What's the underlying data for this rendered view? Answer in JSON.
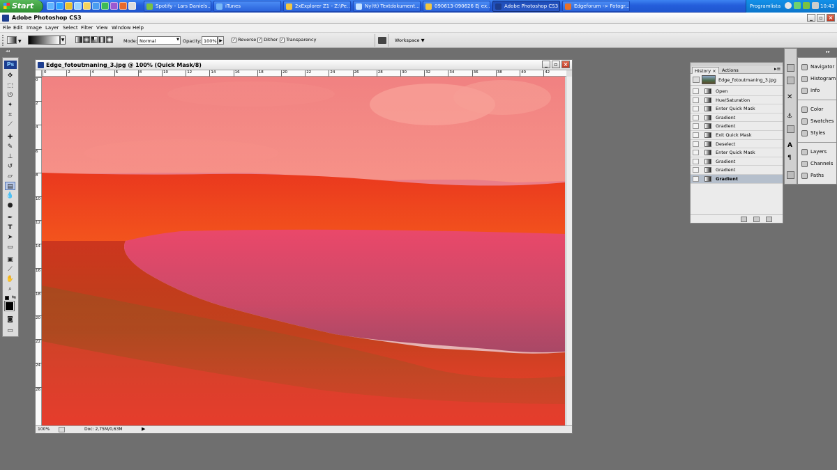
{
  "taskbar": {
    "start_label": "Start",
    "buttons": [
      {
        "label": "Spotify - Lars Daniels...",
        "icon": "spotify-icon",
        "active": false
      },
      {
        "label": "iTunes",
        "icon": "itunes-icon",
        "active": false
      },
      {
        "label": "2xExplorer Z1 - Z:\\Pe...",
        "icon": "explorer-icon",
        "active": false
      },
      {
        "label": "Ny(tt) Textdokument...",
        "icon": "notepad-icon",
        "active": false
      },
      {
        "label": "090613-090626 Ej ex...",
        "icon": "folder-icon",
        "active": false
      },
      {
        "label": "Adobe Photoshop CS3",
        "icon": "photoshop-icon",
        "active": true
      },
      {
        "label": "Edgeforum -> Fotogr...",
        "icon": "firefox-icon",
        "active": false
      }
    ],
    "tray_label": "Programlista",
    "clock": "10:43"
  },
  "app": {
    "title": "Adobe Photoshop CS3",
    "logo_text": "Ps"
  },
  "menu": [
    "File",
    "Edit",
    "Image",
    "Layer",
    "Select",
    "Filter",
    "View",
    "Window",
    "Help"
  ],
  "options": {
    "mode_label": "Mode:",
    "mode_value": "Normal",
    "opacity_label": "Opacity:",
    "opacity_value": "100%",
    "reverse_label": "Reverse",
    "dither_label": "Dither",
    "transparency_label": "Transparency",
    "workspace_label": "Workspace"
  },
  "document": {
    "title": "Edge_fotoutmaning_3.jpg @ 100% (Quick Mask/8)",
    "zoom": "100%",
    "doc_info": "Doc: 2,75M/0,63M",
    "h_ruler_ticks": [
      "0",
      "2",
      "4",
      "6",
      "8",
      "10",
      "12",
      "14",
      "16",
      "18",
      "20",
      "22",
      "24",
      "26",
      "28",
      "30",
      "32",
      "34",
      "36",
      "38",
      "40",
      "42"
    ],
    "v_ruler_ticks": [
      "0",
      "2",
      "4",
      "6",
      "8",
      "10",
      "12",
      "14",
      "16",
      "18",
      "20",
      "22",
      "24",
      "26"
    ]
  },
  "history_panel": {
    "tabs": [
      "History",
      "Actions"
    ],
    "snapshot": "Edge_fotoutmaning_3.jpg",
    "steps": [
      "Open",
      "Hue/Saturation",
      "Enter Quick Mask",
      "Gradient",
      "Gradient",
      "Exit Quick Mask",
      "Deselect",
      "Enter Quick Mask",
      "Gradient",
      "Gradient",
      "Gradient"
    ],
    "active_step": 10
  },
  "dock_panels": {
    "group1": [
      "Navigator",
      "Histogram",
      "Info"
    ],
    "group2": [
      "Color",
      "Swatches",
      "Styles"
    ],
    "group3": [
      "Layers",
      "Channels",
      "Paths"
    ]
  }
}
